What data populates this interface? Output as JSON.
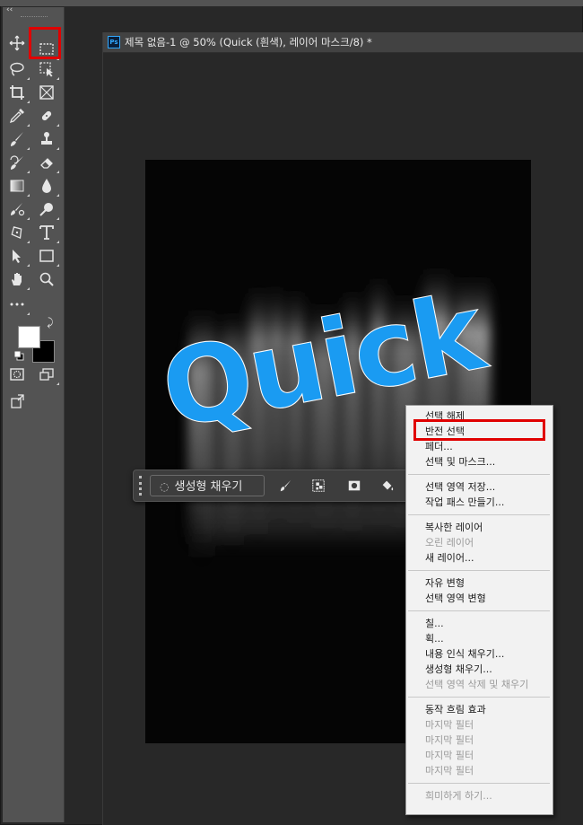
{
  "document": {
    "tab_title": "제목 없음-1 @ 50% (Quick (흰색), 레이어 마스크/8) *",
    "canvas_text": "Quick",
    "ps_badge": "Ps"
  },
  "toolbar": {
    "collapse": "‹‹",
    "tools": [
      "move-icon",
      "rectangular-marquee-icon",
      "lasso-icon",
      "object-selection-icon",
      "crop-icon",
      "frame-icon",
      "eyedropper-icon",
      "spot-healing-icon",
      "brush-icon",
      "clone-stamp-icon",
      "history-brush-icon",
      "eraser-icon",
      "gradient-icon",
      "blur-icon",
      "dodge-icon",
      "zoom-sponge-icon",
      "pen-icon",
      "type-icon",
      "path-selection-icon",
      "rectangle-icon",
      "hand-icon",
      "zoom-icon",
      "more-tools-icon"
    ],
    "foreground_color": "#ffffff",
    "background_color": "#000000"
  },
  "contextual_taskbar": {
    "generative_fill_label": "생성형 채우기"
  },
  "context_menu": {
    "items": [
      {
        "label": "선택 해제",
        "enabled": true
      },
      {
        "label": "반전 선택",
        "enabled": true
      },
      {
        "label": "페더...",
        "enabled": true
      },
      {
        "label": "선택 및 마스크...",
        "enabled": true
      },
      {
        "label": "선택 영역 저장...",
        "enabled": true
      },
      {
        "label": "작업 패스 만들기...",
        "enabled": true
      },
      {
        "label": "복사한 레이어",
        "enabled": true
      },
      {
        "label": "오린 레이어",
        "enabled": false
      },
      {
        "label": "새 레이어...",
        "enabled": true
      },
      {
        "label": "자유 변형",
        "enabled": true
      },
      {
        "label": "선택 영역 변형",
        "enabled": true
      },
      {
        "label": "칠...",
        "enabled": true
      },
      {
        "label": "획...",
        "enabled": true
      },
      {
        "label": "내용 인식 채우기...",
        "enabled": true
      },
      {
        "label": "생성형 채우기...",
        "enabled": true
      },
      {
        "label": "선택 영역 삭제 및 채우기",
        "enabled": false
      },
      {
        "label": "동작 흐림 효과",
        "enabled": true
      },
      {
        "label": "마지막 필터",
        "enabled": false
      },
      {
        "label": "마지막 필터",
        "enabled": false
      },
      {
        "label": "마지막 필터",
        "enabled": false
      },
      {
        "label": "마지막 필터",
        "enabled": false
      },
      {
        "label": "희미하게 하기...",
        "enabled": false
      }
    ]
  },
  "colors": {
    "accent_text": "#1a9bf2",
    "highlight_box": "#e00000"
  }
}
